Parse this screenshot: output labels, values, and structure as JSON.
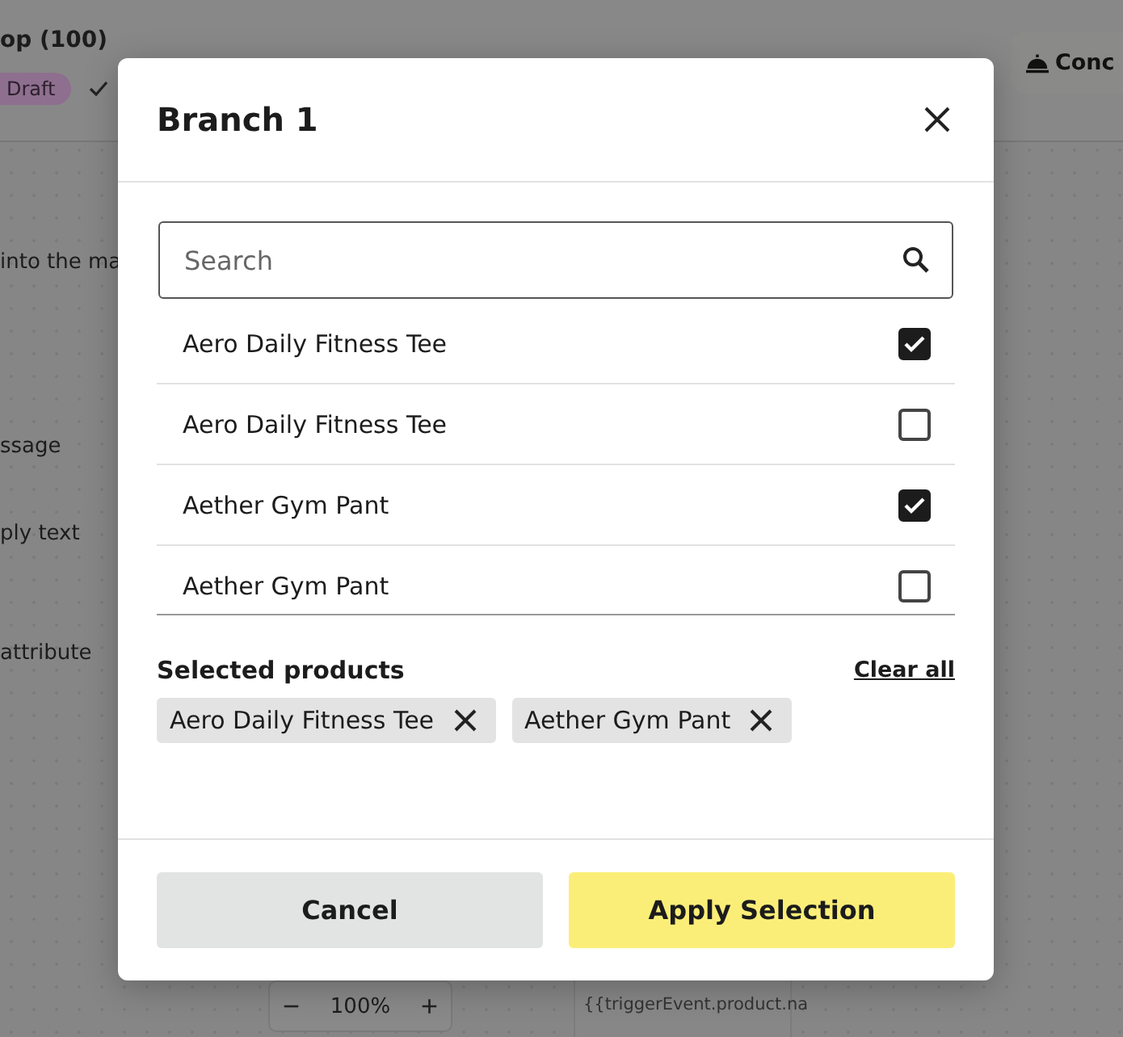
{
  "background": {
    "heading": "op (100)",
    "status_badge": "Draft",
    "left_texts": [
      "into the ma",
      "ssage",
      "ply text",
      "attribute"
    ],
    "concierge_button": "Conc",
    "zoom": {
      "minus": "−",
      "value": "100%",
      "plus": "+"
    },
    "message_preview": "{{triggerEvent.product.na"
  },
  "dialog": {
    "title": "Branch 1",
    "search": {
      "placeholder": "Search"
    },
    "products": [
      {
        "name": "Aero Daily Fitness Tee",
        "checked": true
      },
      {
        "name": "Aero Daily Fitness Tee",
        "checked": false
      },
      {
        "name": "Aether Gym Pant",
        "checked": true
      },
      {
        "name": "Aether Gym Pant",
        "checked": false
      }
    ],
    "selected_label": "Selected products",
    "clear_all": "Clear all",
    "chips": [
      "Aero Daily Fitness Tee",
      "Aether Gym Pant"
    ],
    "buttons": {
      "cancel": "Cancel",
      "apply": "Apply Selection"
    }
  }
}
